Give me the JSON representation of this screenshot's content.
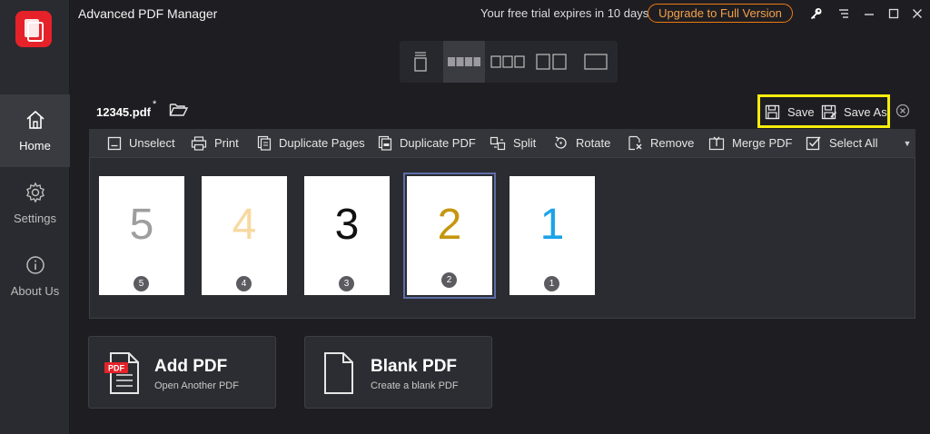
{
  "app": {
    "title": "Advanced PDF Manager",
    "trial_text": "Your free trial expires in 10 days",
    "upgrade_label": "Upgrade to Full Version",
    "title_icons": [
      "key-icon",
      "menu-icon",
      "minimize-icon",
      "maximize-icon",
      "close-icon"
    ]
  },
  "sidebar": {
    "items": [
      {
        "label": "Home",
        "icon": "home-icon",
        "active": true
      },
      {
        "label": "Settings",
        "icon": "gear-icon",
        "active": false
      },
      {
        "label": "About Us",
        "icon": "info-icon",
        "active": false
      }
    ]
  },
  "view_modes": {
    "items": [
      "single-page-view-icon",
      "four-column-view-icon",
      "three-column-view-icon",
      "two-column-view-icon",
      "single-column-view-icon"
    ],
    "active_index": 1
  },
  "file": {
    "name": "12345.pdf",
    "modified_marker": "*"
  },
  "save": {
    "save_label": "Save",
    "save_as_label": "Save As"
  },
  "toolbar": {
    "unselect": "Unselect",
    "print": "Print",
    "duplicate_pages": "Duplicate Pages",
    "duplicate_pdf": "Duplicate PDF",
    "split": "Split",
    "rotate": "Rotate",
    "remove": "Remove",
    "merge_pdf": "Merge PDF",
    "select_all": "Select All"
  },
  "pages": [
    {
      "number": "5",
      "badge": "5",
      "color": "#9e9e9e",
      "selected": false
    },
    {
      "number": "4",
      "badge": "4",
      "color": "#f7d9a0",
      "selected": false
    },
    {
      "number": "3",
      "badge": "3",
      "color": "#111111",
      "selected": false
    },
    {
      "number": "2",
      "badge": "2",
      "color": "#c4960f",
      "selected": true
    },
    {
      "number": "1",
      "badge": "1",
      "color": "#1aa3e8",
      "selected": false
    }
  ],
  "cards": {
    "add_pdf": {
      "title": "Add PDF",
      "subtitle": "Open Another PDF",
      "icon_label": "PDF"
    },
    "blank_pdf": {
      "title": "Blank PDF",
      "subtitle": "Create a blank PDF"
    }
  },
  "colors": {
    "accent_upgrade": "#f07a12",
    "highlight_save": "#f6ee0c",
    "logo_red": "#e52229"
  }
}
